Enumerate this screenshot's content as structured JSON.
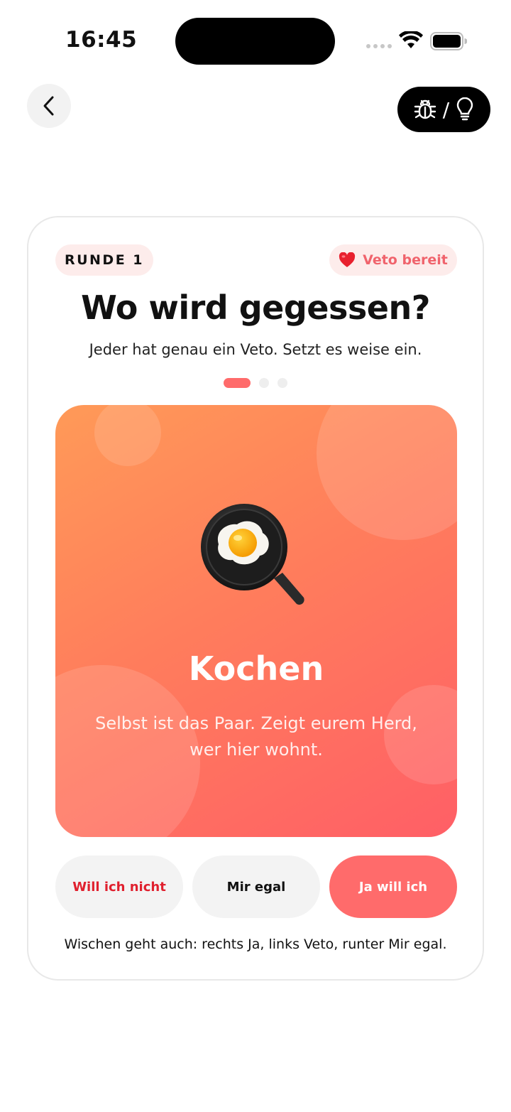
{
  "status_bar": {
    "time": "16:45"
  },
  "header": {
    "back_icon": "chevron-left-icon",
    "debug_icons": [
      "bug-icon",
      "lightbulb-icon"
    ],
    "debug_separator": "/"
  },
  "card": {
    "round_label": "RUNDE 1",
    "veto_label": "Veto bereit",
    "title": "Wo wird gegessen?",
    "subtitle": "Jeder hat genau ein Veto. Setzt es weise ein.",
    "pagination": {
      "current": 1,
      "total": 3
    },
    "option": {
      "icon": "frying-pan-egg-icon",
      "title": "Kochen",
      "description": "Selbst ist das Paar. Zeigt eurem Herd, wer hier wohnt."
    },
    "actions": {
      "no_label": "Will ich nicht",
      "neutral_label": "Mir egal",
      "yes_label": "Ja will ich"
    },
    "hint": "Wischen geht auch: rechts Ja, links Veto, runter Mir egal."
  },
  "colors": {
    "accent": "#ff6b6b",
    "veto_text": "#f0636c",
    "no_text": "#e0202e",
    "badge_bg": "#fdeceb"
  }
}
